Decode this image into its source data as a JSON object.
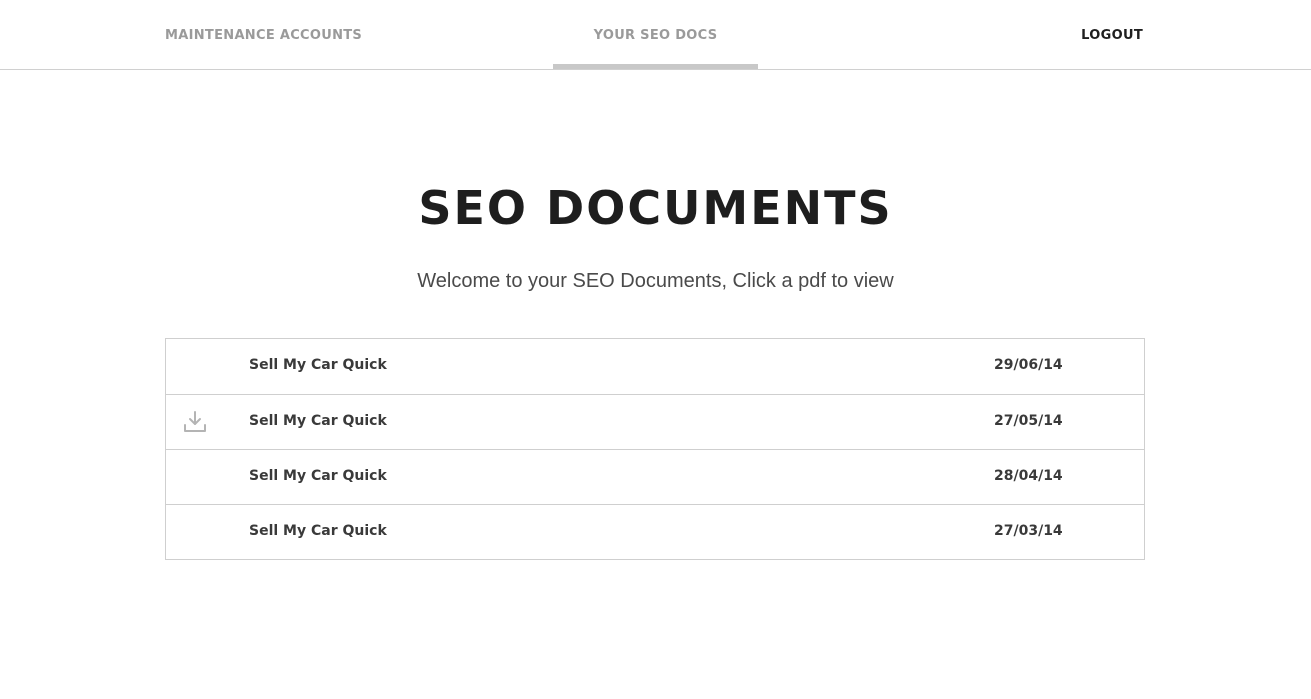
{
  "nav": {
    "maintenance_label": "MAINTENANCE ACCOUNTS",
    "docs_label": "YOUR SEO DOCS",
    "logout_label": "LOGOUT",
    "active_tab": "YOUR SEO DOCS"
  },
  "page": {
    "title": "SEO DOCUMENTS",
    "subtitle": "Welcome to your SEO Documents, Click a pdf to view"
  },
  "documents": [
    {
      "name": "Sell My Car Quick",
      "date": "29/06/14",
      "show_icon": false
    },
    {
      "name": "Sell My Car Quick",
      "date": "27/05/14",
      "show_icon": true,
      "icon": "download-icon"
    },
    {
      "name": "Sell My Car Quick",
      "date": "28/04/14",
      "show_icon": false
    },
    {
      "name": "Sell My Car Quick",
      "date": "27/03/14",
      "show_icon": false
    }
  ],
  "colors": {
    "nav_inactive": "#9a9a9a",
    "nav_logout": "#1f1f1f",
    "active_indicator": "#c8c8c8",
    "border": "#cfcfcf",
    "icon": "#b4b4b4"
  }
}
